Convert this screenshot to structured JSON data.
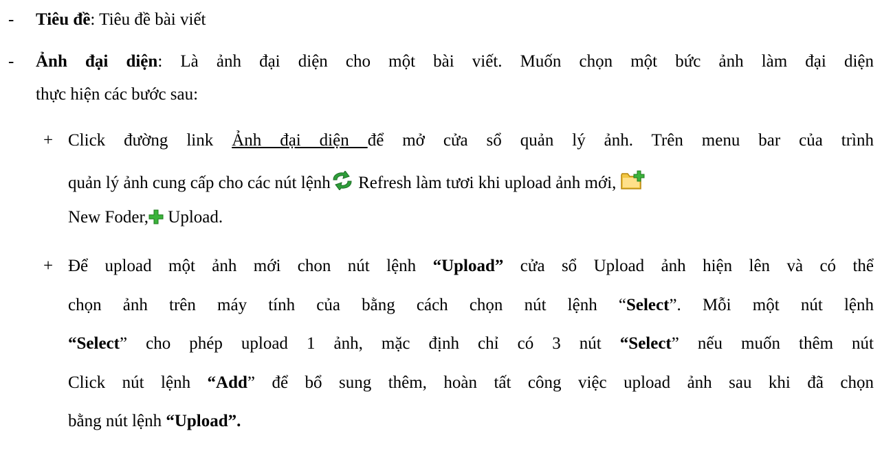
{
  "bullets": {
    "dash": "-",
    "plus": "+"
  },
  "title_item": {
    "label": "Tiêu đề",
    "colon": ":",
    "text": " Tiêu đề bài viết"
  },
  "avatar_item": {
    "label": "Ảnh đại diện",
    "colon": ":",
    "text_line1": " Là ảnh đại diện cho một bài viết. Muốn chọn một bức ảnh làm đại diện",
    "text_line2": "thực hiện các bước sau:"
  },
  "step1": {
    "pre": "Click đường link ",
    "link": "Ảnh đại diện ",
    "post": " để mở cửa sổ quản lý ảnh. Trên menu bar của trình",
    "line2_pre": "quản lý ảnh cung cấp cho các nút lệnh",
    "refresh": " Refresh làm tươi khi upload ảnh mới,",
    "new_folder": "New Foder,",
    "upload": " Upload."
  },
  "step2": {
    "l1_pre": "Để upload một ảnh mới chon nút lệnh ",
    "l1_bold": "“Upload”",
    "l1_post": " cửa sổ Upload ảnh hiện lên và có thể",
    "l2_pre": "chọn ảnh trên máy tính của bằng cách chọn nút lệnh “",
    "l2_bold": "Select",
    "l2_post": "”. Mỗi một nút lệnh",
    "l3_bold1": "“Select",
    "l3_mid": "” cho phép  upload  1 ảnh, mặc định chỉ có 3 nút ",
    "l3_bold2": "“Select",
    "l3_post": "”  nếu  muốn thêm nút",
    "l4_pre": "Click nút lệnh ",
    "l4_bold": "“Add",
    "l4_post": "” để bổ sung thêm, hoàn tất công việc upload ảnh sau khi đã chọn",
    "l5_pre": "bằng nút lệnh ",
    "l5_bold": "“Upload”."
  },
  "icons": {
    "refresh": "refresh-icon",
    "new_folder": "new-folder-icon",
    "upload": "upload-plus-icon",
    "refresh_color": "#2e9e3a",
    "folder_color": "#f2c744",
    "plus_color": "#3bb33b"
  }
}
